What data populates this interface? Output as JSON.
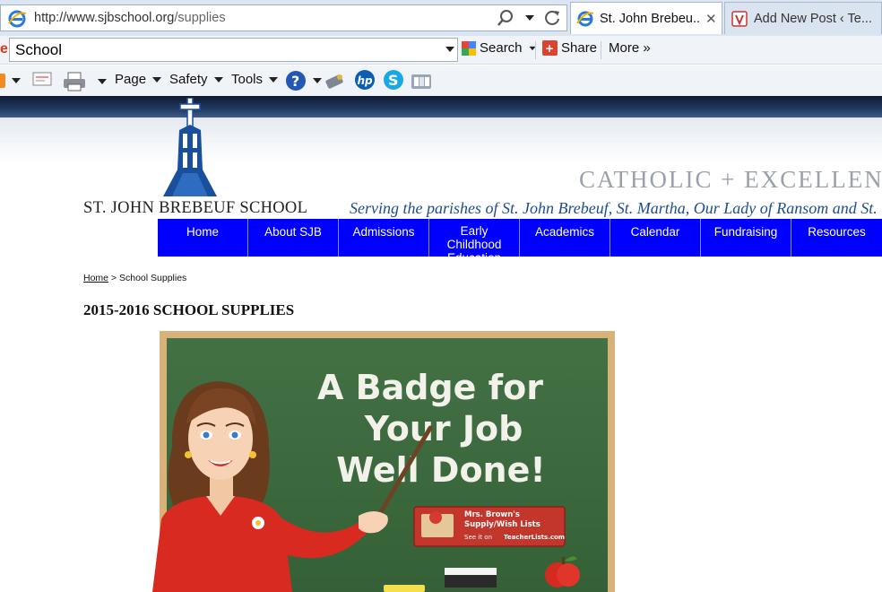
{
  "browser": {
    "url_host": "http://www.sjbschool.org",
    "url_path": "/supplies",
    "tabs": [
      {
        "label": "St. John Brebeu...",
        "close": "✕"
      },
      {
        "label": "Add New Post ‹ Te..."
      }
    ],
    "search_box_value": "School",
    "search_label": "Search",
    "share_label": "Share",
    "more_label": "More »",
    "menu": {
      "page": "Page",
      "safety": "Safety",
      "tools": "Tools"
    },
    "colors": {
      "chrome": "#dce6f2",
      "tab_active": "#ffffff"
    }
  },
  "site": {
    "school_name": "ST. JOHN BREBEUF SCHOOL",
    "motto": "CATHOLIC + EXCELLENT +",
    "parishes": "Serving the parishes of St. John Brebeuf, St. Martha, Our Lady of Ransom and St.",
    "nav": [
      "Home",
      "About SJB",
      "Admissions",
      "Early Childhood Education",
      "Academics",
      "Calendar",
      "Fundraising",
      "Resources"
    ],
    "nav_color": "#0000ff",
    "logo_color": "#1a4f9c"
  },
  "content": {
    "breadcrumb_home": "Home",
    "breadcrumb_sep": " > ",
    "breadcrumb_current": "School Supplies",
    "page_title": "2015-2016 SCHOOL SUPPLIES",
    "chalkboard": {
      "line1": "A Badge for",
      "line2": "Your Job",
      "line3": "Well Done!",
      "badge_line1": "Mrs. Brown's",
      "badge_line2": "Supply/Wish Lists",
      "badge_line3": "See it on",
      "badge_brand": "TeacherLists.com"
    }
  }
}
